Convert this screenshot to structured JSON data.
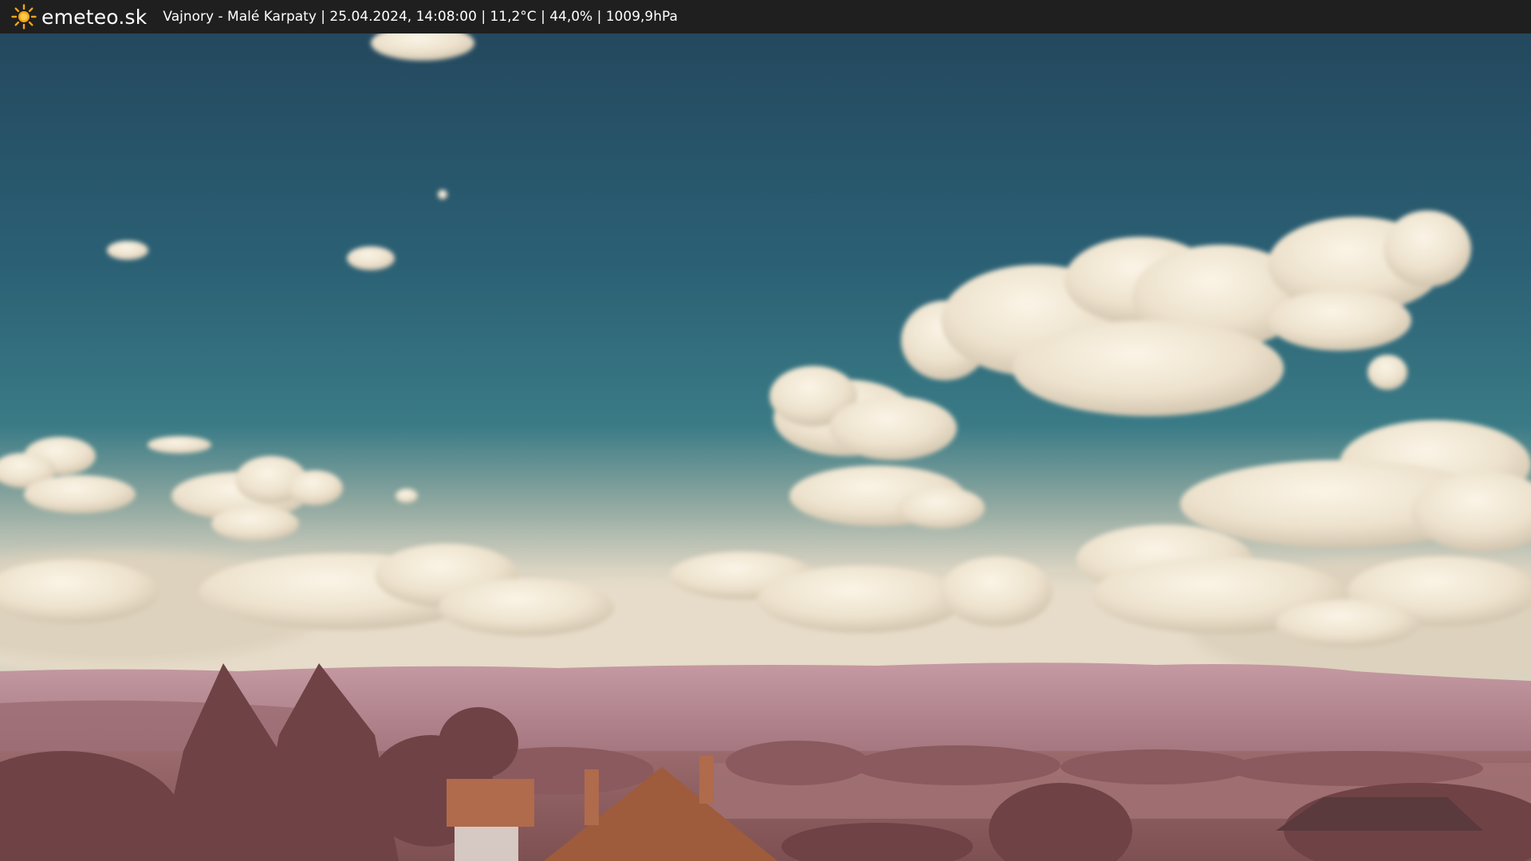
{
  "header": {
    "brand": "emeteo.sk",
    "caption": "Vajnory - Malé Karpaty | 25.04.2024, 14:08:00 | 11,2°C | 44,0% | 1009,9hPa",
    "logo_icon": "sun-icon",
    "background": "#1f1f1f",
    "text_color": "#ffffff",
    "sun_color": "#f4a516"
  },
  "scene": {
    "description_icon": "webcam-image",
    "sky_top": "#24485e",
    "sky_mid": "#2b6577",
    "sky_low": "#3b7a86",
    "cloud_color": "#efe6d6",
    "hill_color": "#b88a92",
    "tree_color": "#7b4b4e",
    "roof_color": "#a45f3e"
  }
}
